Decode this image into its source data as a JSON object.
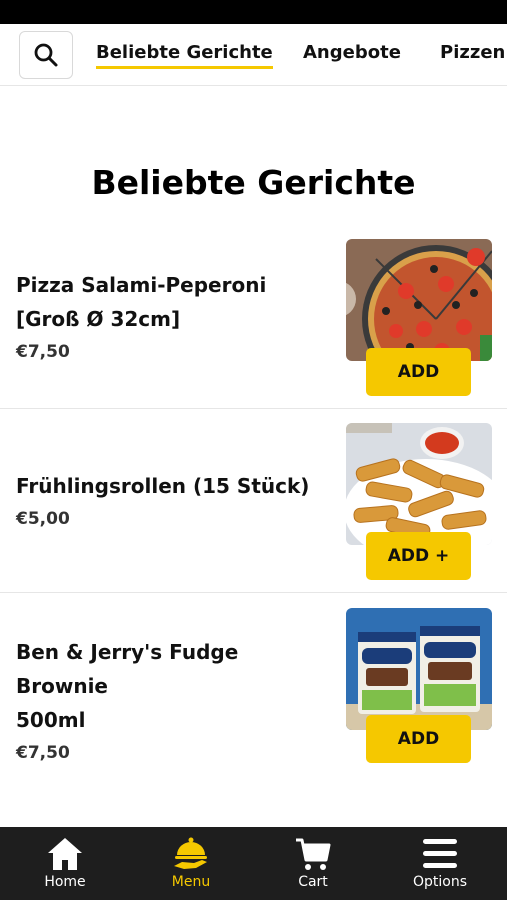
{
  "top_nav": {
    "search_icon": "search-icon",
    "tabs": [
      {
        "label": "Beliebte Gerichte",
        "active": true
      },
      {
        "label": "Angebote",
        "active": false
      },
      {
        "label": "Pizzen",
        "active": false
      }
    ]
  },
  "section": {
    "title": "Beliebte Gerichte"
  },
  "items": [
    {
      "name_line1": "Pizza Salami-Peperoni",
      "name_line2": "[Groß Ø 32cm]",
      "price": "€7,50",
      "button": "ADD",
      "image": "pizza-image"
    },
    {
      "name_line1": "Frühlingsrollen (15 Stück)",
      "name_line2": "",
      "price": "€5,00",
      "button": "ADD +",
      "image": "spring-rolls-image"
    },
    {
      "name_line1": "Ben & Jerry's Fudge Brownie",
      "name_line2": "500ml",
      "price": "€7,50",
      "button": "ADD",
      "image": "ice-cream-image"
    }
  ],
  "bottom_nav": [
    {
      "label": "Home",
      "icon": "home-icon",
      "active": false
    },
    {
      "label": "Menu",
      "icon": "menu-cloche-icon",
      "active": true
    },
    {
      "label": "Cart",
      "icon": "cart-icon",
      "active": false
    },
    {
      "label": "Options",
      "icon": "hamburger-icon",
      "active": false
    }
  ],
  "colors": {
    "accent": "#f5c800",
    "bottom_bar": "#1e1e1e",
    "status_bar": "#000000"
  }
}
